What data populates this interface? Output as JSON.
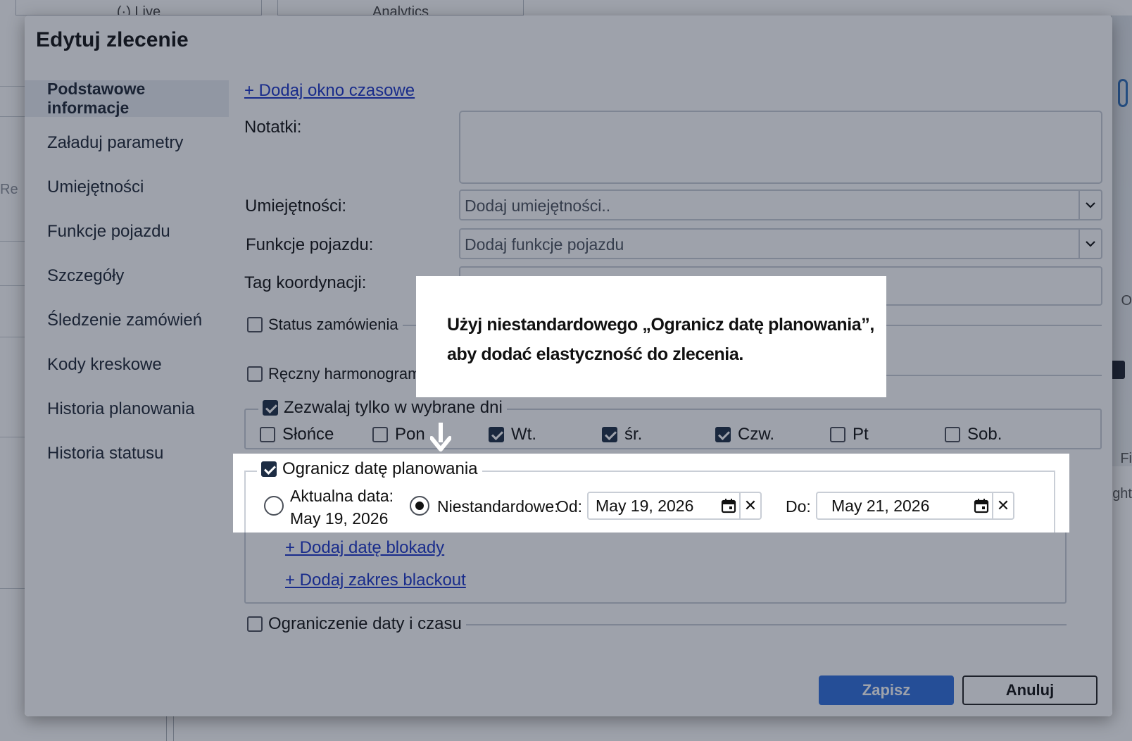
{
  "background": {
    "tabs": [
      "(·) Live",
      "Analytics"
    ],
    "left_text": "Re",
    "right_texts": [
      "O",
      "Fi",
      "ght"
    ]
  },
  "modal": {
    "title": "Edytuj zlecenie",
    "nav": [
      {
        "label": "Podstawowe informacje",
        "active": true
      },
      {
        "label": "Załaduj parametry"
      },
      {
        "label": "Umiejętności"
      },
      {
        "label": "Funkcje pojazdu"
      },
      {
        "label": "Szczegóły"
      },
      {
        "label": "Śledzenie zamówień"
      },
      {
        "label": "Kody kreskowe"
      },
      {
        "label": "Historia planowania"
      },
      {
        "label": "Historia statusu"
      }
    ],
    "add_time_window": "+ Dodaj okno czasowe",
    "notes_label": "Notatki:",
    "skills_label": "Umiejętności:",
    "skills_placeholder": "Dodaj umiejętności..",
    "vehicle_label": "Funkcje pojazdu:",
    "vehicle_placeholder": "Dodaj funkcje pojazdu",
    "coord_tag_label": "Tag koordynacji:",
    "order_status": "Status zamówienia",
    "manual_schedule": "Ręczny harmonogram",
    "allow_days": "Zezwalaj tylko w wybrane dni",
    "days": [
      {
        "label": "Słońce",
        "checked": false
      },
      {
        "label": "Pon",
        "checked": false
      },
      {
        "label": "Wt.",
        "checked": true
      },
      {
        "label": "śr.",
        "checked": true
      },
      {
        "label": "Czw.",
        "checked": true
      },
      {
        "label": "Pt",
        "checked": false
      },
      {
        "label": "Sob.",
        "checked": false
      }
    ],
    "limit_date": "Ogranicz datę planowania",
    "current_date_label": "Aktualna data:",
    "current_date_value": "May 19, 2026",
    "custom_label": "Niestandardowe:",
    "from_label": "Od:",
    "from_value": "May 19, 2026",
    "to_label": "Do:",
    "to_value": "May 21, 2026",
    "add_block_date": "+ Dodaj datę blokady",
    "add_blackout_range": "+ Dodaj zakres blackout",
    "date_time_limit": "Ograniczenie daty i czasu",
    "save": "Zapisz",
    "cancel": "Anuluj"
  },
  "tooltip": {
    "line1": "Użyj niestandardowego „Ogranicz datę planowania”,",
    "line2": "aby dodać elastyczność do zlecenia."
  },
  "colors": {
    "primary": "#2f6fdd",
    "link": "#1a35c8",
    "overlay": "rgba(24,34,56,0.42)"
  }
}
